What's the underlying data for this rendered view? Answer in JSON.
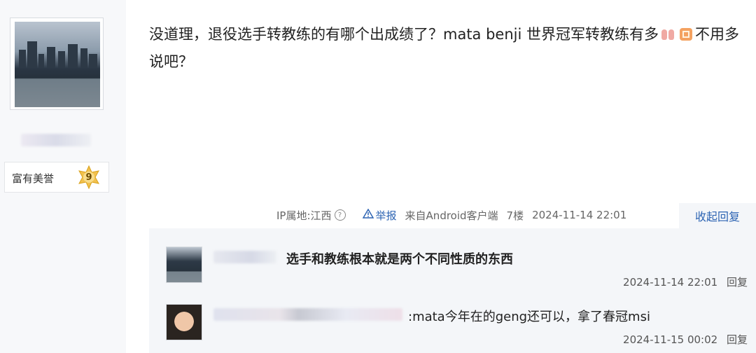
{
  "user": {
    "honor_title": "富有美誉",
    "level": "9"
  },
  "post": {
    "text_part1": "没道理，退役选手转教练的有哪个出成绩了？mata benji 世界冠军转教练有多",
    "emoji1": "lungs-emoji",
    "emoji2": "box-emoji",
    "text_part2": "不用多说吧？"
  },
  "meta": {
    "ip_location": "IP属地:江西",
    "report_label": "举报",
    "source": "来自Android客户端",
    "floor": "7楼",
    "time": "2024-11-14 22:01",
    "collapse_label": "收起回复"
  },
  "replies": [
    {
      "text": "选手和教练根本就是两个不同性质的东西",
      "time": "2024-11-14 22:01",
      "reply_label": "回复"
    },
    {
      "text": ":mata今年在的geng还可以，拿了春冠msi",
      "time": "2024-11-15 00:02",
      "reply_label": "回复"
    }
  ],
  "colors": {
    "link_blue": "#2d64b3",
    "panel_bg": "#f4f6f9",
    "badge_gold": "#f2c14e"
  }
}
